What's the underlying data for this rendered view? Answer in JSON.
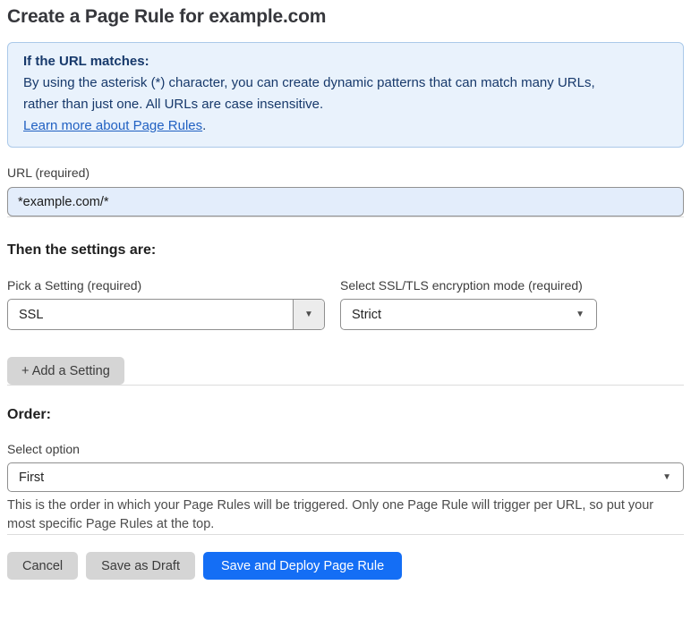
{
  "page": {
    "title": "Create a Page Rule for example.com"
  },
  "info_box": {
    "heading": "If the URL matches:",
    "body_line1": "By using the asterisk (*) character, you can create dynamic patterns that can match many URLs,",
    "body_line2": "rather than just one. All URLs are case insensitive.",
    "link_label": "Learn more about Page Rules",
    "link_suffix": "."
  },
  "url_field": {
    "label": "URL (required)",
    "value": "*example.com/*"
  },
  "settings_section": {
    "heading": "Then the settings are:",
    "setting_select": {
      "label": "Pick a Setting (required)",
      "value": "SSL"
    },
    "mode_select": {
      "label": "Select SSL/TLS encryption mode (required)",
      "value": "Strict"
    },
    "add_setting_label": "+ Add a Setting"
  },
  "order_section": {
    "heading": "Order:",
    "select_label": "Select option",
    "select_value": "First",
    "help_line1": "This is the order in which your Page Rules will be triggered. Only one Page Rule will trigger per URL, so put your",
    "help_line2": "most specific Page Rules at the top."
  },
  "footer": {
    "cancel_label": "Cancel",
    "save_draft_label": "Save as Draft",
    "save_deploy_label": "Save and Deploy Page Rule"
  },
  "icons": {
    "dropdown_arrow": "▼"
  },
  "colors": {
    "primary_button_blue": "#146ef5",
    "info_box_background": "#e9f2fc",
    "info_box_border": "#abc9e9",
    "info_text_navy": "#17396b",
    "link_blue": "#2161c2",
    "url_input_background": "#e3edfb",
    "gray_button": "#d5d5d5",
    "select_border": "#8f8f8f",
    "divider": "#dcdcdc"
  }
}
